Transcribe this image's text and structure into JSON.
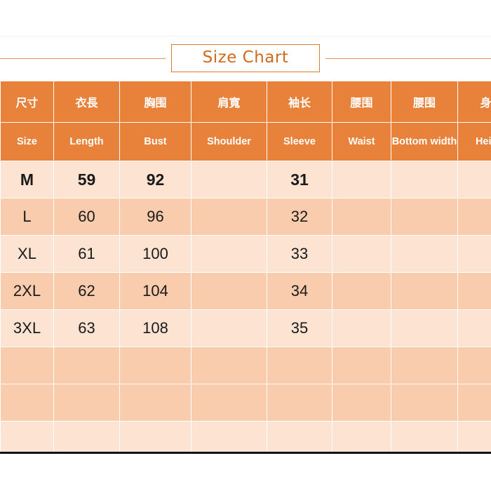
{
  "title": {
    "text": "Size Chart"
  },
  "colors": {
    "header_bg": "#E8813A",
    "row_light": "#FCE3D2",
    "row_dark": "#F8CCAC",
    "title_text": "#D2691E",
    "title_border": "#E07B33",
    "grid_line": "#FFFFFF",
    "bottom_border": "#111111"
  },
  "table": {
    "headers_cn": [
      "尺寸",
      "衣長",
      "胸围",
      "肩寬",
      "袖长",
      "腰围",
      "腰围",
      "身高"
    ],
    "headers_en": [
      "Size",
      "Length",
      "Bust",
      "Shoulder",
      "Sleeve",
      "Waist",
      "Bottom width",
      "Height"
    ],
    "rows": [
      {
        "size": "M",
        "length": "59",
        "bust": "92",
        "shoulder": "",
        "sleeve": "31",
        "waist": "",
        "bottom_width": "",
        "height": "",
        "emphasis": true,
        "shade": "light"
      },
      {
        "size": "L",
        "length": "60",
        "bust": "96",
        "shoulder": "",
        "sleeve": "32",
        "waist": "",
        "bottom_width": "",
        "height": "",
        "emphasis": false,
        "shade": "dark"
      },
      {
        "size": "XL",
        "length": "61",
        "bust": "100",
        "shoulder": "",
        "sleeve": "33",
        "waist": "",
        "bottom_width": "",
        "height": "",
        "emphasis": false,
        "shade": "light"
      },
      {
        "size": "2XL",
        "length": "62",
        "bust": "104",
        "shoulder": "",
        "sleeve": "34",
        "waist": "",
        "bottom_width": "",
        "height": "",
        "emphasis": false,
        "shade": "dark"
      },
      {
        "size": "3XL",
        "length": "63",
        "bust": "108",
        "shoulder": "",
        "sleeve": "35",
        "waist": "",
        "bottom_width": "",
        "height": "",
        "emphasis": false,
        "shade": "light"
      },
      {
        "size": "",
        "length": "",
        "bust": "",
        "shoulder": "",
        "sleeve": "",
        "waist": "",
        "bottom_width": "",
        "height": "",
        "emphasis": false,
        "shade": "dark"
      },
      {
        "size": "",
        "length": "",
        "bust": "",
        "shoulder": "",
        "sleeve": "",
        "waist": "",
        "bottom_width": "",
        "height": "",
        "emphasis": false,
        "shade": "dark"
      },
      {
        "size": "",
        "length": "",
        "bust": "",
        "shoulder": "",
        "sleeve": "",
        "waist": "",
        "bottom_width": "",
        "height": "",
        "emphasis": false,
        "shade": "light"
      }
    ]
  }
}
